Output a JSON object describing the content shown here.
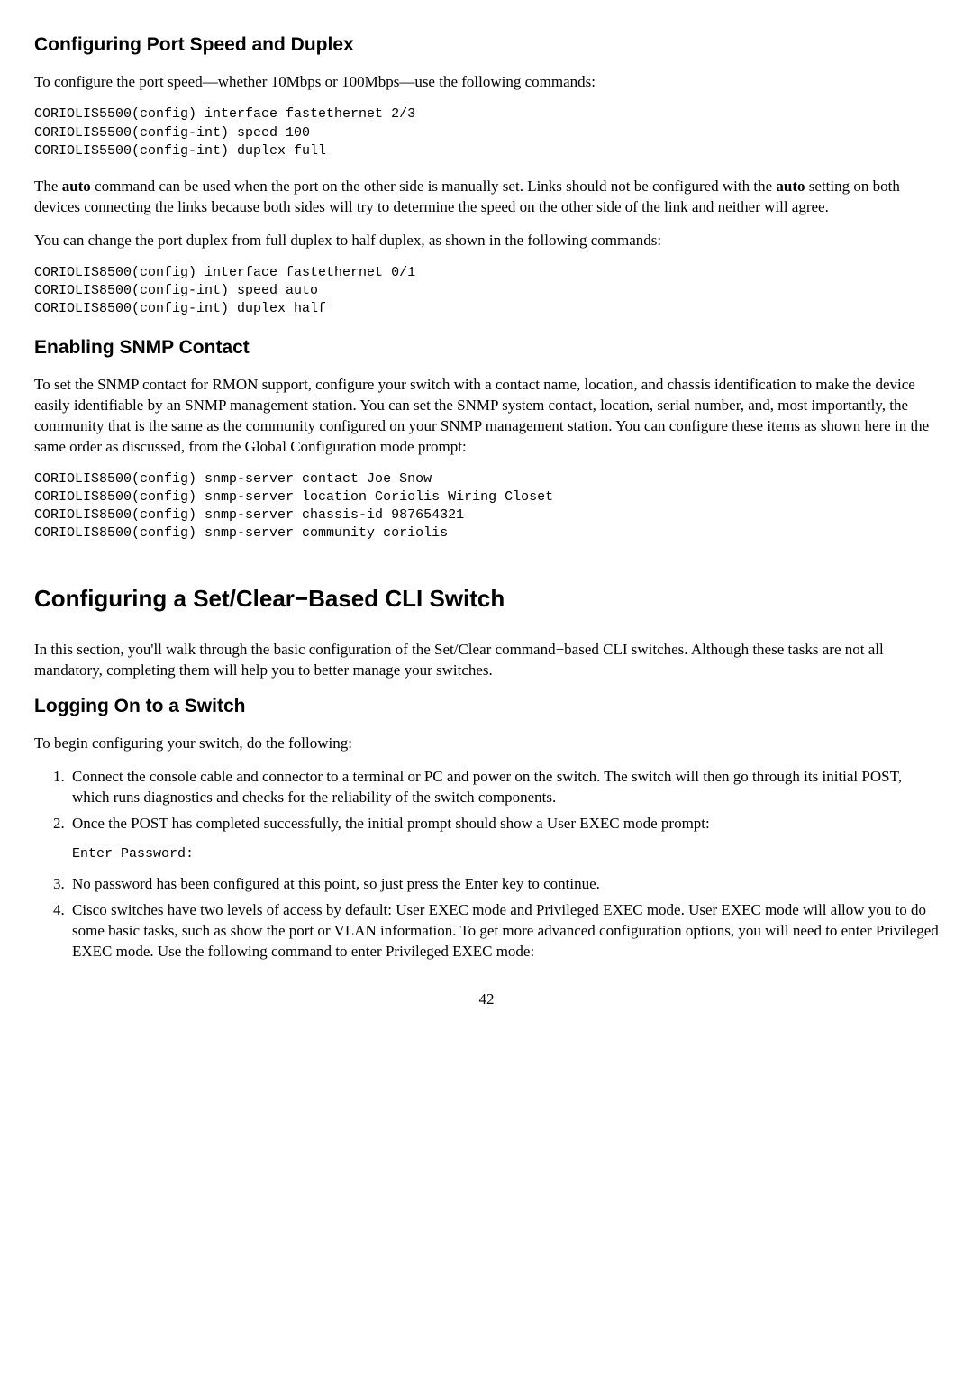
{
  "sec1": {
    "heading": "Configuring Port Speed and Duplex",
    "p1": "To configure the port speed—whether 10Mbps or 100Mbps—use the following commands:",
    "code1": "CORIOLIS5500(config) interface fastethernet 2/3\nCORIOLIS5500(config-int) speed 100\nCORIOLIS5500(config-int) duplex full",
    "p2a": "The ",
    "p2b": "auto",
    "p2c": " command can be used when the port on the other side is manually set. Links should not be configured with the ",
    "p2d": "auto",
    "p2e": " setting on both devices connecting the links because both sides will try to determine the speed on the other side of the link and neither will agree.",
    "p3": "You can change the port duplex from full duplex to half duplex, as shown in the following commands:",
    "code2": "CORIOLIS8500(config) interface fastethernet 0/1\nCORIOLIS8500(config-int) speed auto\nCORIOLIS8500(config-int) duplex half"
  },
  "sec2": {
    "heading": "Enabling SNMP Contact",
    "p1": "To set the SNMP contact for RMON support, configure your switch with a contact name, location, and chassis identification to make the device easily identifiable by an SNMP management station. You can set the SNMP system contact, location, serial number, and, most importantly, the community that is the same as the community configured on your SNMP management station. You can configure these items as shown here in the same order as discussed, from the Global Configuration mode prompt:",
    "code1": "CORIOLIS8500(config) snmp-server contact Joe Snow\nCORIOLIS8500(config) snmp-server location Coriolis Wiring Closet\nCORIOLIS8500(config) snmp-server chassis-id 987654321\nCORIOLIS8500(config) snmp-server community coriolis"
  },
  "sec3": {
    "heading": "Configuring a Set/Clear−Based CLI Switch",
    "p1": "In this section, you'll walk through the basic configuration of the Set/Clear command−based CLI switches. Although these tasks are not all mandatory, completing them will help you to better manage your switches."
  },
  "sec4": {
    "heading": "Logging On to a Switch",
    "p1": "To begin configuring your switch, do the following:",
    "li1": "Connect the console cable and connector to a terminal or PC and power on the switch. The switch will then go through its initial POST, which runs diagnostics and checks for the reliability of the switch components.",
    "li2": "Once the POST has completed successfully, the initial prompt should show a User EXEC mode prompt:",
    "li2code": "Enter Password:",
    "li3": "No password has been configured at this point, so just press the Enter key to continue.",
    "li4": "Cisco switches have two levels of access by default: User EXEC mode and Privileged EXEC mode. User EXEC mode will allow you to do some basic tasks, such as show the port or VLAN information. To get more advanced configuration options, you will need to enter Privileged EXEC mode. Use the following command to enter Privileged EXEC mode:"
  },
  "page_number": "42"
}
